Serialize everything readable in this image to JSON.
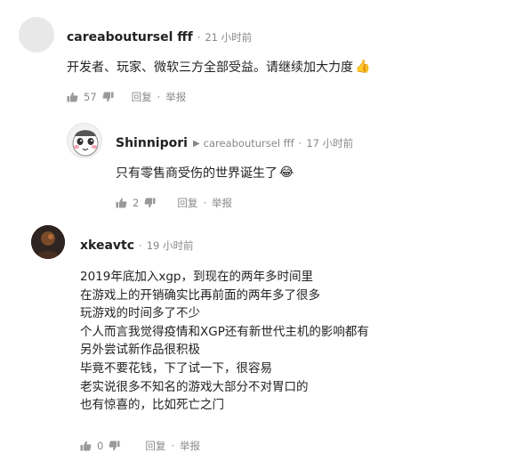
{
  "comments": [
    {
      "username": "careaboutursel fff",
      "time": "21 小时前",
      "text": "开发者、玩家、微软三方全部受益。请继续加大力度",
      "emoji": "👍",
      "likes": "57",
      "reply_label": "回复",
      "report_label": "举报"
    },
    {
      "username": "Shinnipori",
      "reply_to": "careaboutursel fff",
      "time": "17 小时前",
      "text": "只有零售商受伤的世界诞生了",
      "emoji": "😂",
      "likes": "2",
      "reply_label": "回复",
      "report_label": "举报"
    },
    {
      "username": "xkeavtc",
      "time": "19 小时前",
      "lines": [
        "2019年底加入xgp，到现在的两年多时间里",
        "在游戏上的开销确实比再前面的两年多了很多",
        "玩游戏的时间多了不少",
        "个人而言我觉得疫情和XGP还有新世代主机的影响都有",
        "另外尝试新作品很积极",
        "毕竟不要花钱，下了试一下，很容易",
        "老实说很多不知名的游戏大部分不对胃口的",
        "也有惊喜的，比如死亡之门"
      ],
      "likes": "0",
      "reply_label": "回复",
      "report_label": "举报"
    }
  ]
}
